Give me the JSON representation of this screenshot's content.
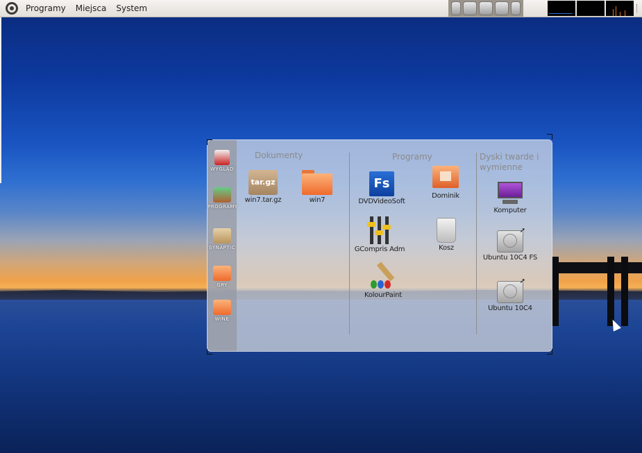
{
  "top_panel": {
    "menus": [
      "Programy",
      "Miejsca",
      "System"
    ]
  },
  "stack": {
    "sidebar": [
      "WYGLĄD",
      "PROGRAMY",
      "SYNAPTIC",
      "GRY",
      "WINE"
    ],
    "columns": [
      {
        "title": "Dokumenty",
        "items": [
          "win7.tar.gz",
          "win7"
        ]
      },
      {
        "title": "Programy",
        "items": [
          "DVDVideoSoft",
          "Dominik",
          "GCompris Adm",
          "Kosz",
          "KolourPaint"
        ]
      },
      {
        "title": "Dyski twarde i wymienne",
        "items": [
          "Komputer",
          "Ubuntu 10C4 FS",
          "Ubuntu 10C4"
        ]
      }
    ]
  },
  "icons": {
    "archive_text": "tar.gz",
    "fs_text": "Fs"
  },
  "colors": {
    "folder": "#ef6a2c",
    "panel_bg": "#e9e6e1"
  }
}
